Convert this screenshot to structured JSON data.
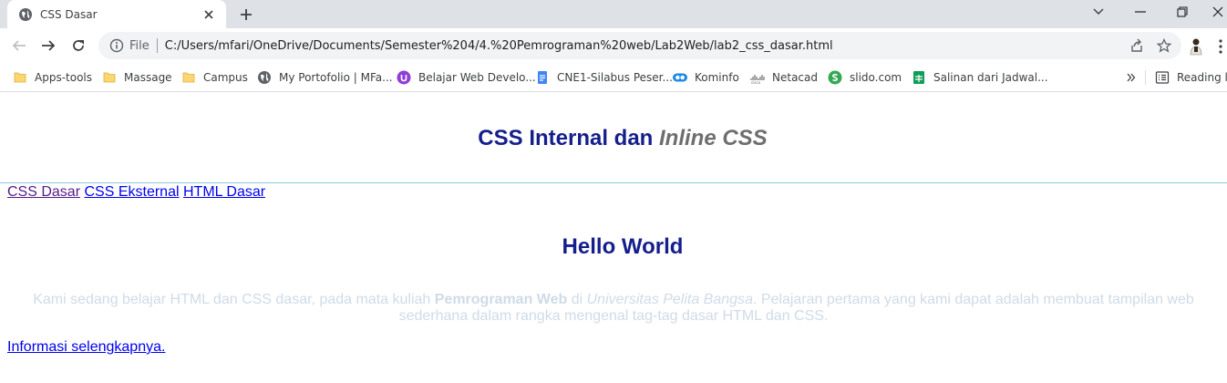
{
  "tab": {
    "title": "CSS Dasar"
  },
  "address_bar": {
    "scheme_label": "File",
    "url": "C:/Users/mfari/OneDrive/Documents/Semester%204/4.%20Pemrograman%20web/Lab2Web/lab2_css_dasar.html"
  },
  "bookmarks": {
    "items": [
      {
        "label": "Apps-tools",
        "icon": "folder-icon"
      },
      {
        "label": "Massage",
        "icon": "folder-icon"
      },
      {
        "label": "Campus",
        "icon": "folder-icon"
      },
      {
        "label": "My Portofolio | MFa...",
        "icon": "globe-icon"
      },
      {
        "label": "Belajar Web Develo...",
        "icon": "purple-circle-icon"
      },
      {
        "label": "CNE1-Silabus Peser...",
        "icon": "docs-icon"
      },
      {
        "label": "Kominfo",
        "icon": "kominfo-icon"
      },
      {
        "label": "Netacad",
        "icon": "cisco-icon"
      },
      {
        "label": "slido.com",
        "icon": "slido-icon"
      },
      {
        "label": "Salinan dari Jadwal...",
        "icon": "sheets-icon"
      }
    ],
    "reading_list": "Reading list"
  },
  "page": {
    "title_plain": "CSS Internal dan ",
    "title_em": "Inline CSS",
    "nav": [
      "CSS Dasar",
      "CSS Eksternal",
      "HTML Dasar"
    ],
    "hello": "Hello World",
    "para": {
      "p1": "Kami sedang belajar HTML dan CSS dasar, pada mata kuliah ",
      "strong": "Pemrograman Web",
      "p2": " di ",
      "em": "Universitas Pelita Bangsa",
      "p3": ". Pelajaran pertama yang kami dapat adalah membuat tampilan web sederhana dalam rangka mengenal tag-tag dasar HTML dan CSS."
    },
    "info_link": "Informasi selengkapnya."
  },
  "colors": {
    "heading": "#141e8c",
    "heading_em": "#6e6e6e",
    "paragraph": "#cfdbe8",
    "rule": "#8ec7e0"
  }
}
